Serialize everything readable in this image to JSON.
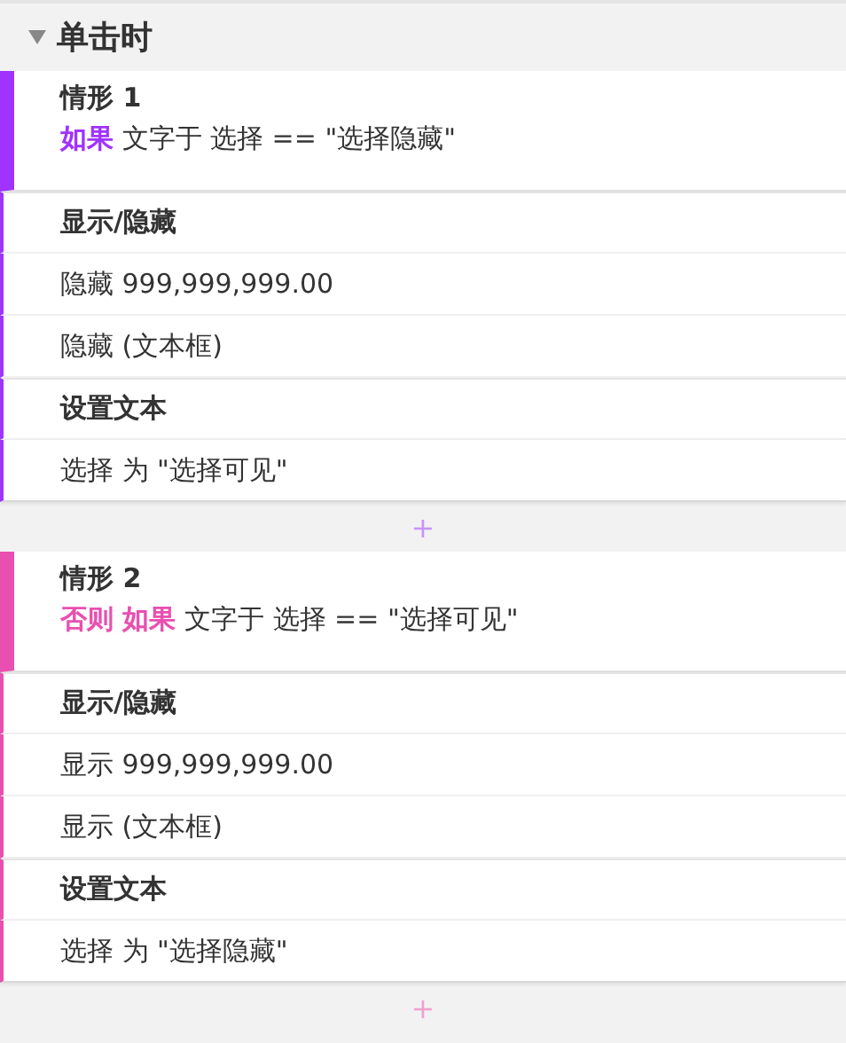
{
  "event": {
    "title": "单击时",
    "expanded": true
  },
  "cases": [
    {
      "title": "情形 1",
      "color": "#a033ff",
      "condition": "**如果** 文字于 选择 == \"选择隐藏\"",
      "actions": [
        {
          "title": "显示/隐藏",
          "items": [
            "隐藏 999,999,999.00",
            "隐藏 (文本框)"
          ]
        },
        {
          "title": "设置文本",
          "items": [
            "选择 为 \"选择可见\""
          ]
        }
      ],
      "add_label": "+"
    },
    {
      "title": "情形 2",
      "color": "#e94fb0",
      "condition": "**否则 如果** 文字于 选择 == \"选择可见\"",
      "actions": [
        {
          "title": "显示/隐藏",
          "items": [
            "显示 999,999,999.00",
            "显示 (文本框)"
          ]
        },
        {
          "title": "设置文本",
          "items": [
            "选择 为 \"选择隐藏\""
          ]
        }
      ],
      "add_label": "+"
    }
  ]
}
